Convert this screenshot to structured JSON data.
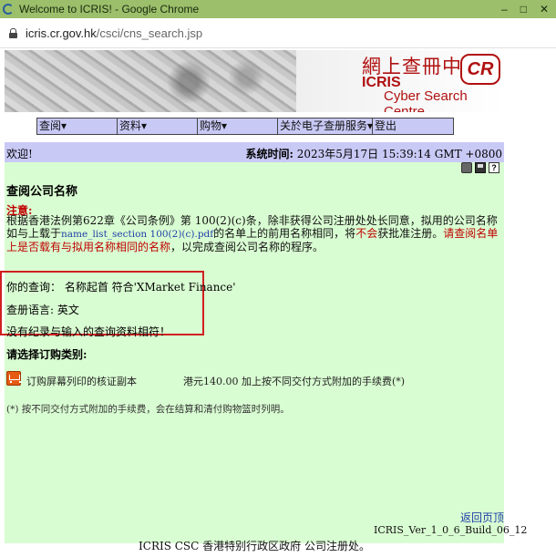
{
  "window": {
    "title": "Welcome to ICRIS! - Google Chrome",
    "controls": {
      "minimize": "–",
      "maximize": "□",
      "close": "✕"
    }
  },
  "address": {
    "domain": "icris.cr.gov.hk",
    "path": "/csci/cns_search.jsp"
  },
  "banner": {
    "chinese_title": "網上查冊中心",
    "icris": "ICRIS",
    "cyber_search_centre": "Cyber Search Centre",
    "logo_text": "CR"
  },
  "menu": {
    "items": [
      {
        "label": "查阅▾"
      },
      {
        "label": "资料▾"
      },
      {
        "label": "购物▾"
      },
      {
        "label": "关於电子查册服务▾"
      },
      {
        "label": "登出"
      }
    ]
  },
  "header": {
    "welcome": "欢迎!",
    "system_time_label": "系统时间:",
    "system_time_value": "2023年5月17日 15:39:14 GMT +0800"
  },
  "toolbar_icons": [
    "printer-icon",
    "save-icon",
    "help-icon"
  ],
  "help_glyph": "?",
  "page": {
    "title": "查阅公司名称",
    "note_label": "注意:",
    "para_part1": "根据香港法例第622章《公司条例》第 100(2)(c)条，除非获得公司注册处处长同意，拟用的公司名称如与上载于",
    "para_link": "name_list_section 100(2)(c).pdf",
    "para_part2": "的名单上的前用名称相同，将",
    "para_red1": "不会",
    "para_part3": "获批准注册。",
    "para_red2": "请查阅名单上是否载有与拟用名称相同的名称",
    "para_part4": "，以完成查阅公司名称的程序。"
  },
  "query": {
    "your_query": "你的查询： 名称起首 符合'XMarket Finance'",
    "language": "查册语言: 英文",
    "result": "没有纪录与输入的查询资料相符！"
  },
  "purchase": {
    "title": "请选择订购类别:",
    "product": "订购屏幕列印的核证副本",
    "price": "港元140.00 加上按不同交付方式附加的手续费(*)",
    "footnote": "(*) 按不同交付方式附加的手续费，会在结算和清付购物篮时列明。"
  },
  "links": {
    "back_to_top": "返回页顶"
  },
  "version": "ICRIS_Ver_1_0_6_Build_06_12",
  "footer": "ICRIS CSC 香港特别行政区政府 公司注册处。"
}
